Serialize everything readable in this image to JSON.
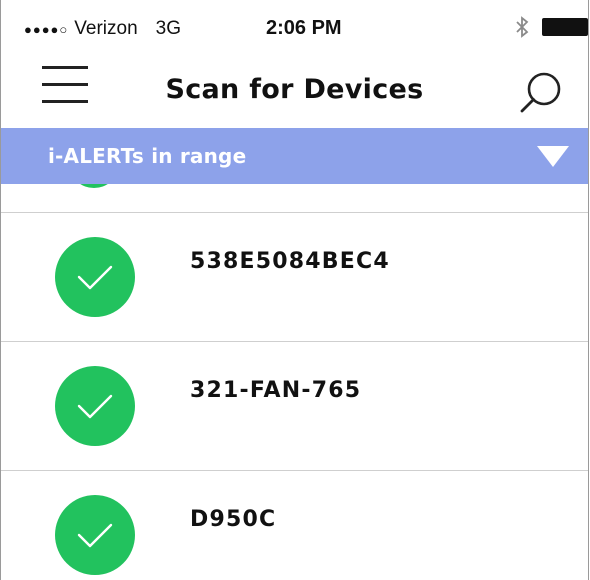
{
  "status_bar": {
    "signal": "●●●●○",
    "carrier": "Verizon",
    "network": "3G",
    "time": "2:06 PM",
    "bluetooth_icon": "bluetooth-icon",
    "battery_icon": "battery-icon"
  },
  "nav": {
    "title": "Scan for Devices",
    "menu_icon": "hamburger-menu-icon",
    "search_icon": "search-icon"
  },
  "section": {
    "label": "i-ALERTs in range",
    "expand_icon": "triangle-down-icon",
    "color": "#8da2ea"
  },
  "devices": [
    {
      "name": "538E5084BEC4",
      "status_icon": "check-icon"
    },
    {
      "name": "321-FAN-765",
      "status_icon": "check-icon"
    },
    {
      "name": "D950C",
      "status_icon": "check-icon"
    }
  ],
  "colors": {
    "accent_green": "#22c25e",
    "header_blue": "#8da2ea"
  }
}
